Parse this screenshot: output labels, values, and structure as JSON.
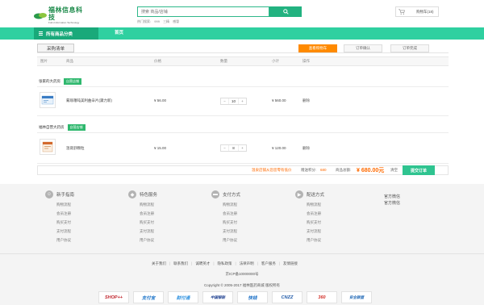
{
  "header": {
    "logo_cn": "福林信息科技",
    "logo_en": "Fulin Information Technology",
    "search_placeholder": "搜索 商品/店铺",
    "hot_label": "热门搜索:",
    "hot_terms": [
      "999",
      "三精",
      "感冒"
    ],
    "cart_label": "购物车(18)"
  },
  "nav": {
    "all_categories": "所有商品分类",
    "home": "首页"
  },
  "cart": {
    "title": "采购清单",
    "steps": [
      "查看购物车",
      "订单确认",
      "订单完成"
    ],
    "columns": [
      "图片",
      "商品",
      "价格",
      "数量",
      "小计",
      "操作"
    ],
    "stores": [
      {
        "name": "张家的大药房",
        "tag": "自营店铺",
        "items": [
          {
            "name": "氟哌噻吨美利曲辛片(黛力新)",
            "price": "¥ 56.00",
            "qty": "10",
            "subtotal": "¥ 560.00",
            "action": "删除"
          }
        ]
      },
      {
        "name": "福林自营大药房",
        "tag": "自营店铺",
        "items": [
          {
            "name": "温肾舒颗粒",
            "price": "¥ 15.00",
            "qty": "8",
            "subtotal": "¥ 120.00",
            "action": "删除"
          }
        ]
      }
    ],
    "summary": {
      "warning": "温泉店铺从您您零有低价",
      "points_label": "赠送积分:",
      "points_value": "680",
      "total_label": "商品总额:",
      "total_value": "¥ 680.00元",
      "clear": "清空",
      "submit": "提交订单"
    }
  },
  "footer": {
    "columns": [
      {
        "title": "新手指南",
        "icon": "user-icon",
        "items": [
          "购物流程",
          "会员注册",
          "购买支付",
          "支付流程",
          "用户协议"
        ]
      },
      {
        "title": "特色服务",
        "icon": "tag-icon",
        "items": [
          "购物流程",
          "会员注册",
          "购买支付",
          "支付流程",
          "用户协议"
        ]
      },
      {
        "title": "支付方式",
        "icon": "wallet-icon",
        "items": [
          "购物流程",
          "会员注册",
          "购买支付",
          "支付流程",
          "用户协议"
        ]
      },
      {
        "title": "配送方式",
        "icon": "truck-icon",
        "items": [
          "购物流程",
          "会员注册",
          "购买支付",
          "支付流程",
          "用户协议"
        ]
      }
    ],
    "wechat": [
      "官方微信",
      "官方微信"
    ],
    "links": [
      "关于我们",
      "联系我们",
      "诚聘英才",
      "隐私政策",
      "法律声明",
      "客户服务",
      "友情链接"
    ],
    "icp": "京ICP备10000000号",
    "copyright": "Copyright © 2005-2017 福林医药商城 版权所有",
    "badges": [
      "SHOP++",
      "支付宝",
      "财付通",
      "中国银联",
      "快钱",
      "CNZZ",
      "360",
      "安全联盟"
    ]
  },
  "colors": {
    "brand": "#2fd0a0",
    "accent": "#ff8a00",
    "submit": "#2fc490"
  }
}
